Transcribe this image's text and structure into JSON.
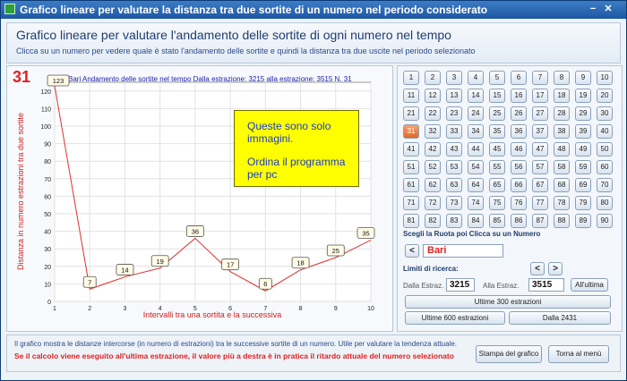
{
  "window": {
    "title": "Grafico lineare per valutare la distanza tra due sortite di un numero nel periodo considerato"
  },
  "header": {
    "title": "Grafico lineare per valutare l'andamento delle sortite di ogni numero nel tempo",
    "subtitle": "Clicca su un numero per vedere quale è stato l'andamento delle sortite e quindi la distanza tra due uscite  nel periodo selezionato"
  },
  "chart": {
    "selected_number": "31",
    "heading": "Bari Andamento  delle sortite nel tempo Dalla estrazione: 3215 alla estrazione: 3515 N. 31",
    "notice_line1": "Queste sono solo immagini.",
    "notice_line2": "Ordina il programma per pc"
  },
  "chart_data": {
    "type": "line",
    "x": [
      1,
      2,
      3,
      4,
      5,
      6,
      7,
      8,
      9,
      10
    ],
    "values": [
      123,
      7,
      14,
      19,
      36,
      17,
      6,
      18,
      25,
      35
    ],
    "data_labels": [
      "123",
      "7",
      "14",
      "19",
      "36",
      "17",
      "6",
      "18",
      "25",
      "35"
    ],
    "xlabel": "Intervalli tra una sortita e la successiva",
    "ylabel": "Distanza in numero estrazioni tra due sortite",
    "xticks": [
      "1",
      "2",
      "3",
      "4",
      "5",
      "6",
      "7",
      "8",
      "9",
      "10"
    ],
    "yticks": [
      "0",
      "10",
      "20",
      "30",
      "40",
      "50",
      "60",
      "70",
      "80",
      "90",
      "100",
      "110",
      "120"
    ],
    "xlim": [
      1,
      10
    ],
    "ylim": [
      0,
      125
    ],
    "grid": true,
    "line_color": "#e03030"
  },
  "numbers": [
    "1",
    "2",
    "3",
    "4",
    "5",
    "6",
    "7",
    "8",
    "9",
    "10",
    "11",
    "12",
    "13",
    "14",
    "15",
    "16",
    "17",
    "18",
    "19",
    "20",
    "21",
    "22",
    "23",
    "24",
    "25",
    "26",
    "27",
    "28",
    "29",
    "30",
    "31",
    "32",
    "33",
    "34",
    "35",
    "36",
    "37",
    "38",
    "39",
    "40",
    "41",
    "42",
    "43",
    "44",
    "45",
    "46",
    "47",
    "48",
    "49",
    "50",
    "51",
    "52",
    "53",
    "54",
    "55",
    "56",
    "57",
    "58",
    "59",
    "60",
    "61",
    "62",
    "63",
    "64",
    "65",
    "66",
    "67",
    "68",
    "69",
    "70",
    "71",
    "72",
    "73",
    "74",
    "75",
    "76",
    "77",
    "78",
    "79",
    "80",
    "81",
    "82",
    "83",
    "84",
    "85",
    "86",
    "87",
    "88",
    "89",
    "90"
  ],
  "selected_index": 30,
  "controls": {
    "wheel_label": "Scegli la Ruota poi Clicca su un Numero",
    "wheel_prev": "<",
    "wheel_next": ">",
    "wheel_value": "Bari",
    "limits_label": "Limiti di ricerca:",
    "limits_prev": "<",
    "limits_next": ">",
    "from_label": "Dalla Estraz.",
    "from_value": "3215",
    "to_label": "Alla Estraz.",
    "to_value": "3515",
    "last_button": "All'ultima",
    "last300_button": "Ultime 300 estrazioni",
    "last600_button": "Ultime 600 estrazioni",
    "from2431_button": "Dalla 2431"
  },
  "footer": {
    "info": "Il grafico mostra le distanze  intercorse (in numero di estrazioni) tra le successive sortite di un numero. Utile per valutare la tendenza attuale.",
    "warning": "Se il calcolo viene eseguito all'ultima estrazione, il valore più a destra è in pratica il ritardo attuale del numero selezionato",
    "print_button": "Stampa del grafico",
    "menu_button": "Torna al menù"
  }
}
